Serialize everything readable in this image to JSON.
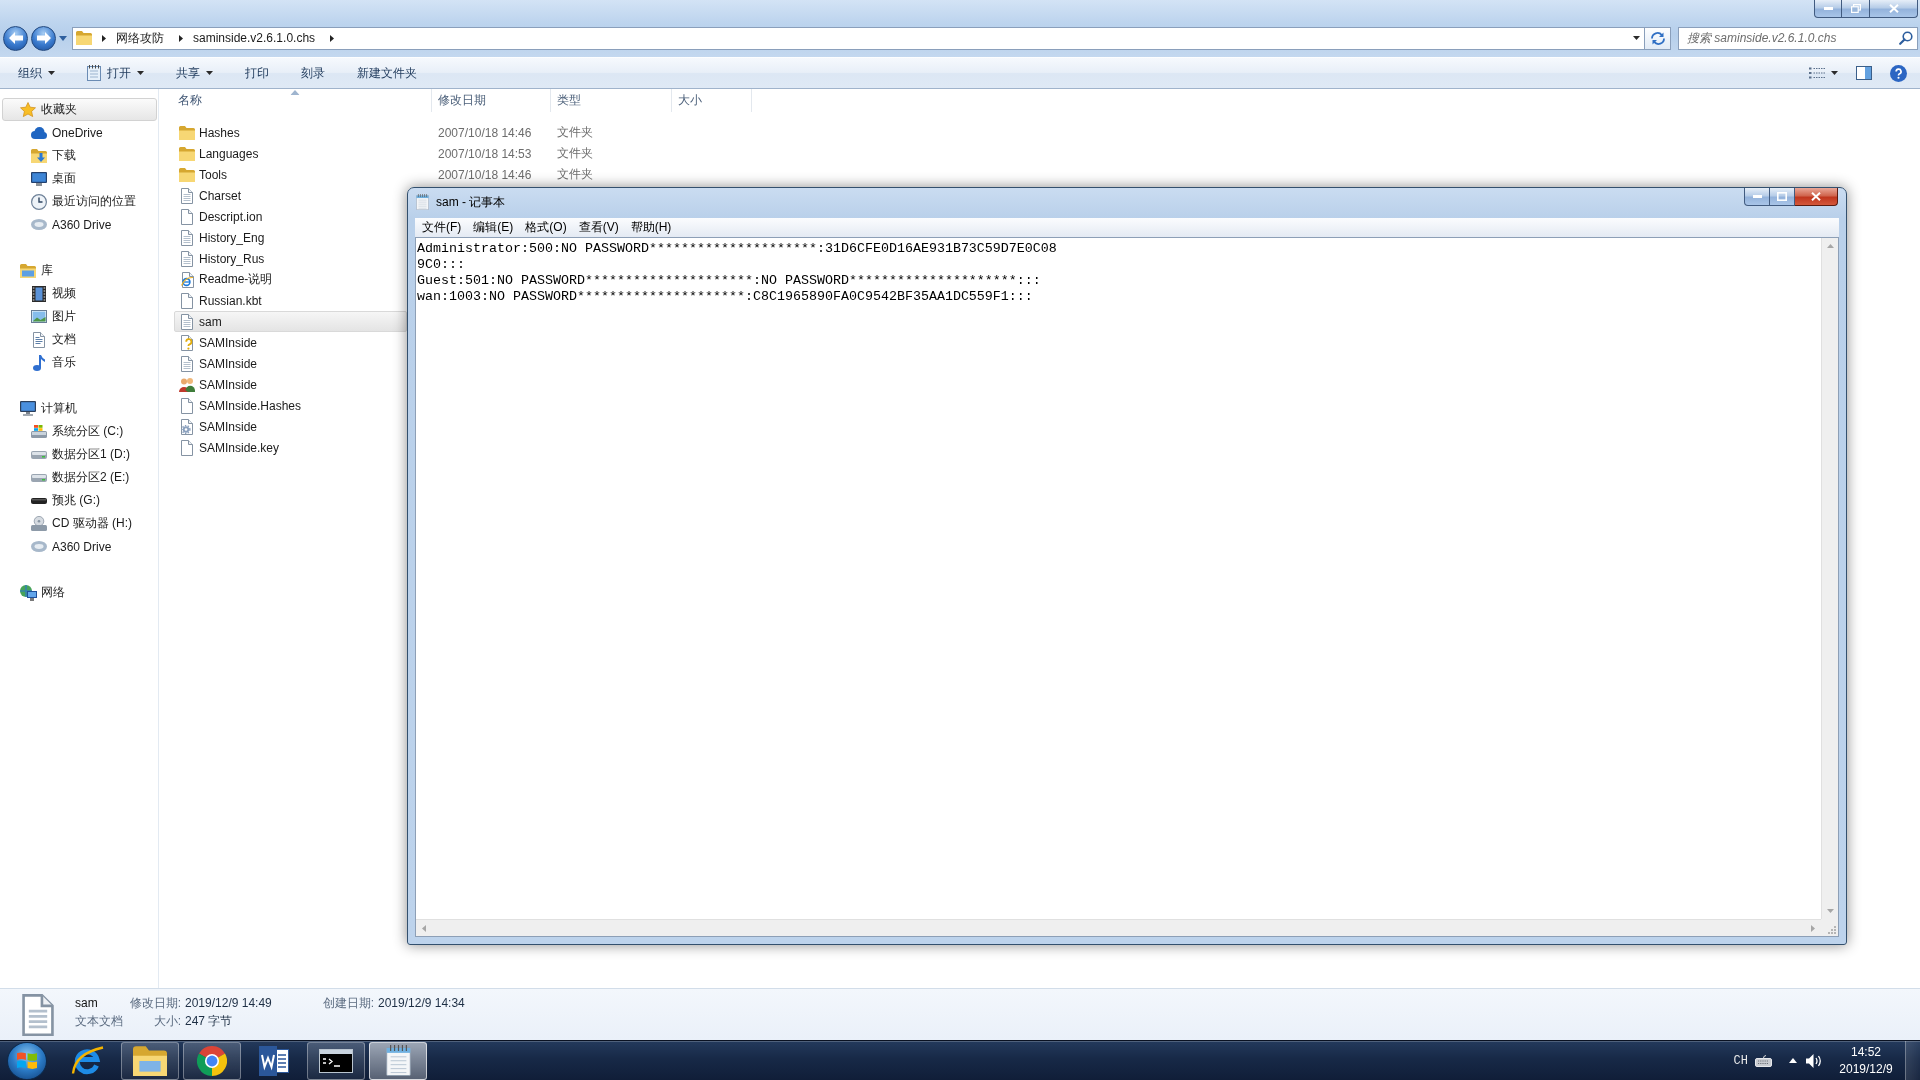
{
  "explorer": {
    "address_bar": {
      "path": [
        "网络攻防",
        "saminside.v2.6.1.0.chs"
      ]
    },
    "search": {
      "placeholder": "搜索 saminside.v2.6.1.0.chs"
    },
    "toolbar": [
      {
        "label": "组织",
        "kind": "menu"
      },
      {
        "label": "打开",
        "kind": "open"
      },
      {
        "label": "共享",
        "kind": "menu"
      },
      {
        "label": "打印",
        "kind": "command"
      },
      {
        "label": "刻录",
        "kind": "command"
      },
      {
        "label": "新建文件夹",
        "kind": "command"
      }
    ],
    "navigation": [
      {
        "label": "收藏夹",
        "kind": "favorites",
        "selected": true,
        "children": [
          {
            "label": "OneDrive",
            "kind": "cloud",
            "selected": false
          },
          {
            "label": "下载",
            "kind": "downloads",
            "selected": false
          },
          {
            "label": "桌面",
            "kind": "desktop",
            "selected": false
          },
          {
            "label": "最近访问的位置",
            "kind": "recent",
            "selected": false
          },
          {
            "label": "A360 Drive",
            "kind": "sync",
            "selected": false
          }
        ]
      },
      {
        "label": "库",
        "kind": "library",
        "selected": false,
        "children": [
          {
            "label": "视频",
            "kind": "videos",
            "selected": false
          },
          {
            "label": "图片",
            "kind": "pictures",
            "selected": false
          },
          {
            "label": "文档",
            "kind": "documents",
            "selected": false
          },
          {
            "label": "音乐",
            "kind": "music",
            "selected": false
          }
        ]
      },
      {
        "label": "计算机",
        "kind": "computer",
        "selected": false,
        "children": [
          {
            "label": "系统分区 (C:)",
            "kind": "sysdrive",
            "selected": false
          },
          {
            "label": "数据分区1 (D:)",
            "kind": "drive",
            "selected": false
          },
          {
            "label": "数据分区2 (E:)",
            "kind": "drive",
            "selected": false
          },
          {
            "label": "预兆 (G:)",
            "kind": "removable",
            "selected": false
          },
          {
            "label": "CD 驱动器 (H:)",
            "kind": "cd",
            "selected": false
          },
          {
            "label": "A360 Drive",
            "kind": "sync",
            "selected": false
          }
        ]
      },
      {
        "label": "网络",
        "kind": "network",
        "selected": false
      }
    ],
    "file_list": {
      "columns": [
        {
          "label": "名称",
          "sorted": true
        },
        {
          "label": "修改日期",
          "sorted": false
        },
        {
          "label": "类型",
          "sorted": false
        },
        {
          "label": "大小",
          "sorted": false
        }
      ],
      "rows": [
        {
          "name": "Hashes",
          "kind": "folder",
          "modified": "2007/10/18 14:46",
          "type": "文件夹",
          "selected": false
        },
        {
          "name": "Languages",
          "kind": "folder",
          "modified": "2007/10/18 14:53",
          "type": "文件夹",
          "selected": false
        },
        {
          "name": "Tools",
          "kind": "folder",
          "modified": "2007/10/18 14:46",
          "type": "文件夹",
          "selected": false
        },
        {
          "name": "Charset",
          "kind": "text",
          "selected": false
        },
        {
          "name": "Descript.ion",
          "kind": "blank",
          "selected": false
        },
        {
          "name": "History_Eng",
          "kind": "text",
          "selected": false
        },
        {
          "name": "History_Rus",
          "kind": "text",
          "selected": false
        },
        {
          "name": "Readme-说明",
          "kind": "web",
          "selected": false
        },
        {
          "name": "Russian.kbt",
          "kind": "blank",
          "selected": false
        },
        {
          "name": "sam",
          "kind": "text",
          "selected": true
        },
        {
          "name": "SAMInside",
          "kind": "help",
          "selected": false
        },
        {
          "name": "SAMInside",
          "kind": "text",
          "selected": false
        },
        {
          "name": "SAMInside",
          "kind": "app",
          "selected": false
        },
        {
          "name": "SAMInside.Hashes",
          "kind": "blank",
          "selected": false
        },
        {
          "name": "SAMInside",
          "kind": "config",
          "selected": false
        },
        {
          "name": "SAMInside.key",
          "kind": "blank",
          "selected": false
        }
      ]
    },
    "details": {
      "name": "sam",
      "type": "文本文档",
      "fields": [
        {
          "label": "修改日期:",
          "value": "2019/12/9 14:49"
        },
        {
          "label": "创建日期:",
          "value": "2019/12/9 14:34"
        },
        {
          "label": "大小:",
          "value": "247 字节"
        }
      ]
    }
  },
  "notepad": {
    "title": "sam - 记事本",
    "menu": [
      "文件(F)",
      "编辑(E)",
      "格式(O)",
      "查看(V)",
      "帮助(H)"
    ],
    "lines": [
      "Administrator:500:NO PASSWORD*********************:31D6CFE0D16AE931B73C59D7E0C08",
      "9C0:::",
      "Guest:501:NO PASSWORD*********************:NO PASSWORD*********************:::",
      "wan:1003:NO PASSWORD*********************:C8C1965890FA0C9542BF35AA1DC559F1:::"
    ]
  },
  "taskbar": {
    "apps": [
      {
        "kind": "ie",
        "running": false,
        "active": false
      },
      {
        "kind": "explorer",
        "running": true,
        "active": false
      },
      {
        "kind": "chrome",
        "running": true,
        "active": false
      },
      {
        "kind": "word",
        "running": false,
        "active": false
      },
      {
        "kind": "cmd",
        "running": true,
        "active": false
      },
      {
        "kind": "notepad",
        "running": true,
        "active": true
      }
    ],
    "input_language": "CH",
    "clock": {
      "time": "14:52",
      "date": "2019/12/9"
    }
  }
}
